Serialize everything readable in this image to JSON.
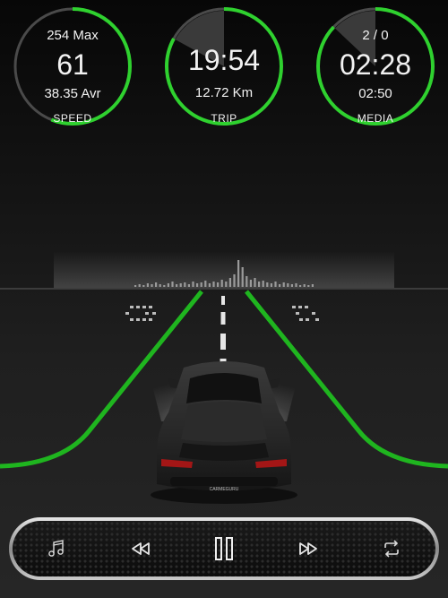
{
  "colors": {
    "accent_green": "#2fd12f",
    "ring_grey": "#4a4a4a",
    "text": "#f2f2f2",
    "road_line": "#1fb51f"
  },
  "speed_gauge": {
    "max_label": "254 Max",
    "current": "61",
    "average_label": "38.35 Avr",
    "caption": "SPEED",
    "progress_fraction": 0.56
  },
  "trip_gauge": {
    "time": "19:54",
    "distance": "12.72 Km",
    "caption": "TRIP",
    "progress_fraction": 0.83
  },
  "media_gauge": {
    "track_index": "2 / 0",
    "elapsed": "02:28",
    "duration": "02:50",
    "caption": "MEDIA",
    "progress_fraction": 0.87
  },
  "scene": {
    "car_plate_text": "CARMEGURU"
  },
  "media_controls": {
    "playlist_icon": "music-note-icon",
    "rewind_icon": "rewind-icon",
    "play_pause_icon": "pause-icon",
    "fast_forward_icon": "fast-forward-icon",
    "repeat_icon": "repeat-icon"
  }
}
